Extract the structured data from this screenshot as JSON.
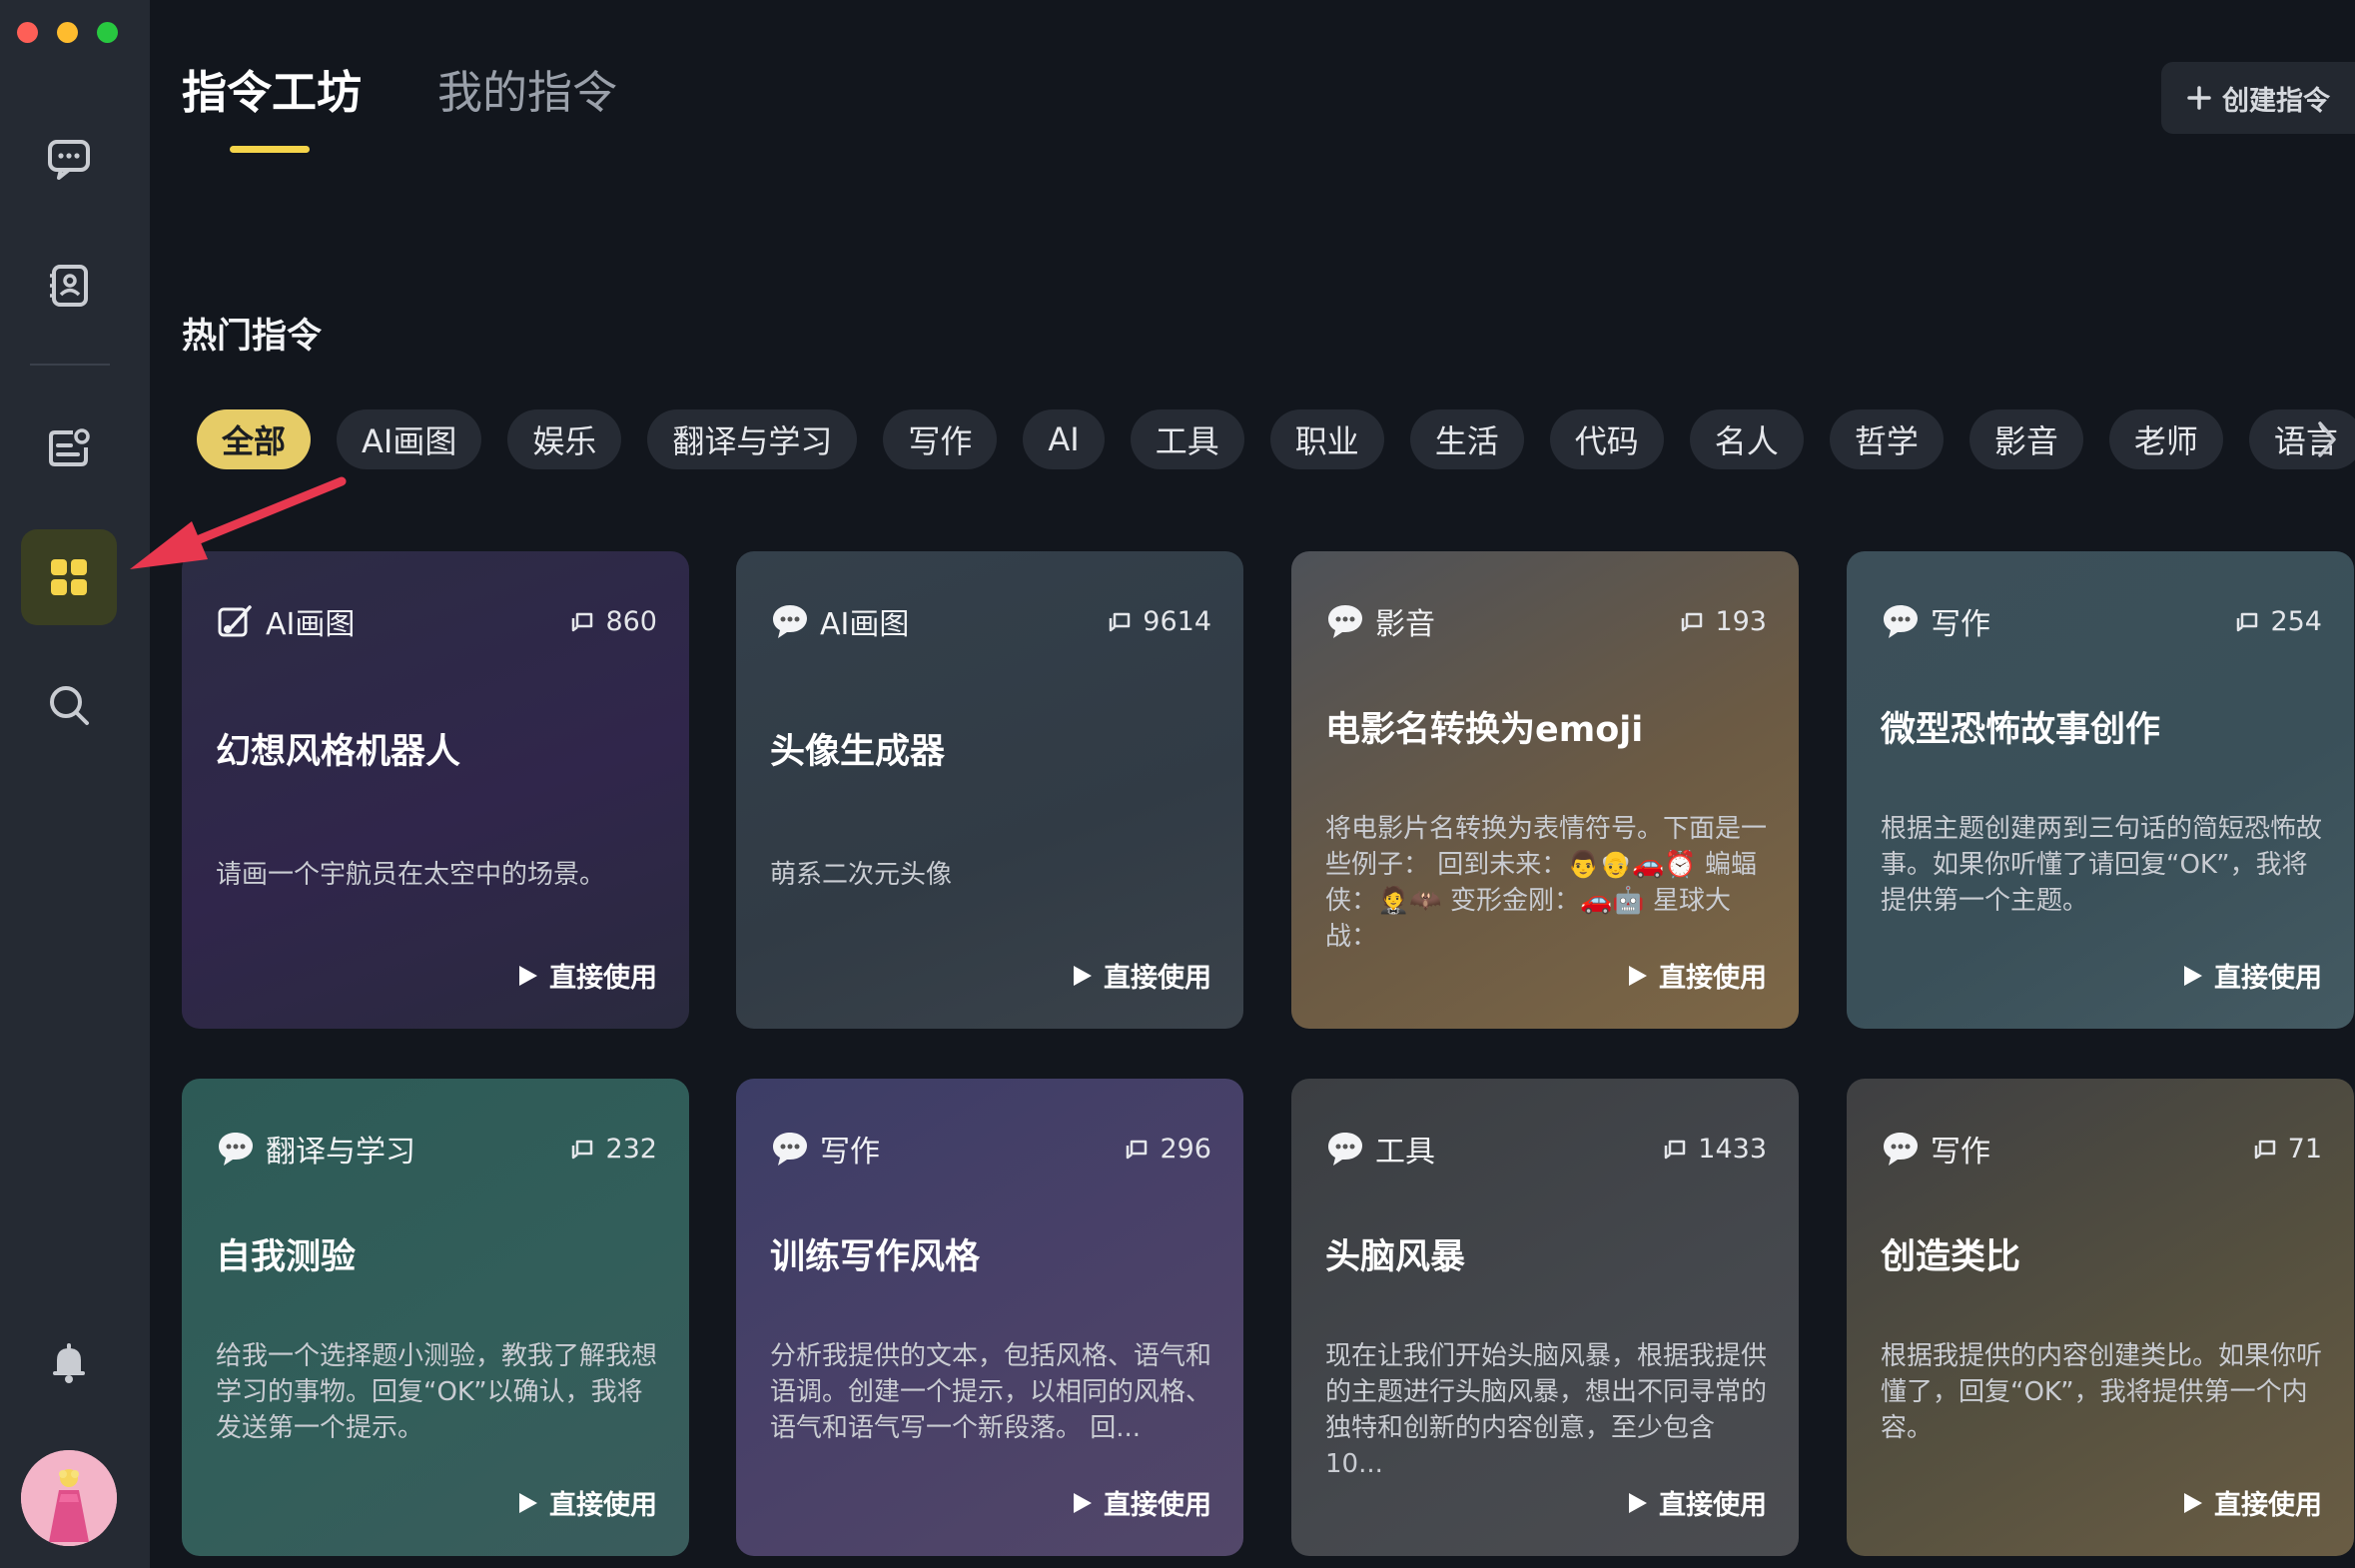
{
  "header": {
    "tabs": [
      {
        "label": "指令工坊",
        "active": true
      },
      {
        "label": "我的指令",
        "active": false
      }
    ],
    "create_button_label": "创建指令"
  },
  "section_title": "热门指令",
  "categories": [
    "全部",
    "AI画图",
    "娱乐",
    "翻译与学习",
    "写作",
    "AI",
    "工具",
    "职业",
    "生活",
    "代码",
    "名人",
    "哲学",
    "影音",
    "老师",
    "语言"
  ],
  "active_category": "全部",
  "use_label": "直接使用",
  "cards": [
    {
      "category": "AI画图",
      "count": "860",
      "title": "幻想风格机器人",
      "description": "请画一个宇航员在太空中的场景。",
      "icon": "paint-icon"
    },
    {
      "category": "AI画图",
      "count": "9614",
      "title": "头像生成器",
      "description": "萌系二次元头像",
      "icon": "chat-bubble-icon"
    },
    {
      "category": "影音",
      "count": "193",
      "title": "电影名转换为emoji",
      "description": "将电影片名转换为表情符号。下面是一些例子： 回到未来：👨👴🚗⏰ 蝙蝠侠：🤵🦇 变形金刚：🚗🤖 星球大战：",
      "icon": "chat-bubble-icon"
    },
    {
      "category": "写作",
      "count": "254",
      "title": "微型恐怖故事创作",
      "description": "根据主题创建两到三句话的简短恐怖故事。如果你听懂了请回复“OK”，我将提供第一个主题。",
      "icon": "chat-bubble-icon"
    },
    {
      "category": "翻译与学习",
      "count": "232",
      "title": "自我测验",
      "description": "给我一个选择题小测验，教我了解我想学习的事物。回复“OK”以确认，我将发送第一个提示。",
      "icon": "chat-bubble-icon"
    },
    {
      "category": "写作",
      "count": "296",
      "title": "训练写作风格",
      "description": "分析我提供的文本，包括风格、语气和语调。创建一个提示，以相同的风格、语气和语气写一个新段落。 回...",
      "icon": "chat-bubble-icon"
    },
    {
      "category": "工具",
      "count": "1433",
      "title": "头脑风暴",
      "description": "现在让我们开始头脑风暴，根据我提供的主题进行头脑风暴，想出不同寻常的独特和创新的内容创意，至少包含10...",
      "icon": "chat-bubble-icon"
    },
    {
      "category": "写作",
      "count": "71",
      "title": "创造类比",
      "description": "根据我提供的内容创建类比。如果你听懂了，回复“OK”，我将提供第一个内容。",
      "icon": "chat-bubble-icon"
    }
  ],
  "colors": {
    "accent": "#f5d44a",
    "active_chip": "#e6cc67",
    "background": "#12161d",
    "sidebar": "#252a33",
    "annotation_arrow": "#e8384f"
  }
}
